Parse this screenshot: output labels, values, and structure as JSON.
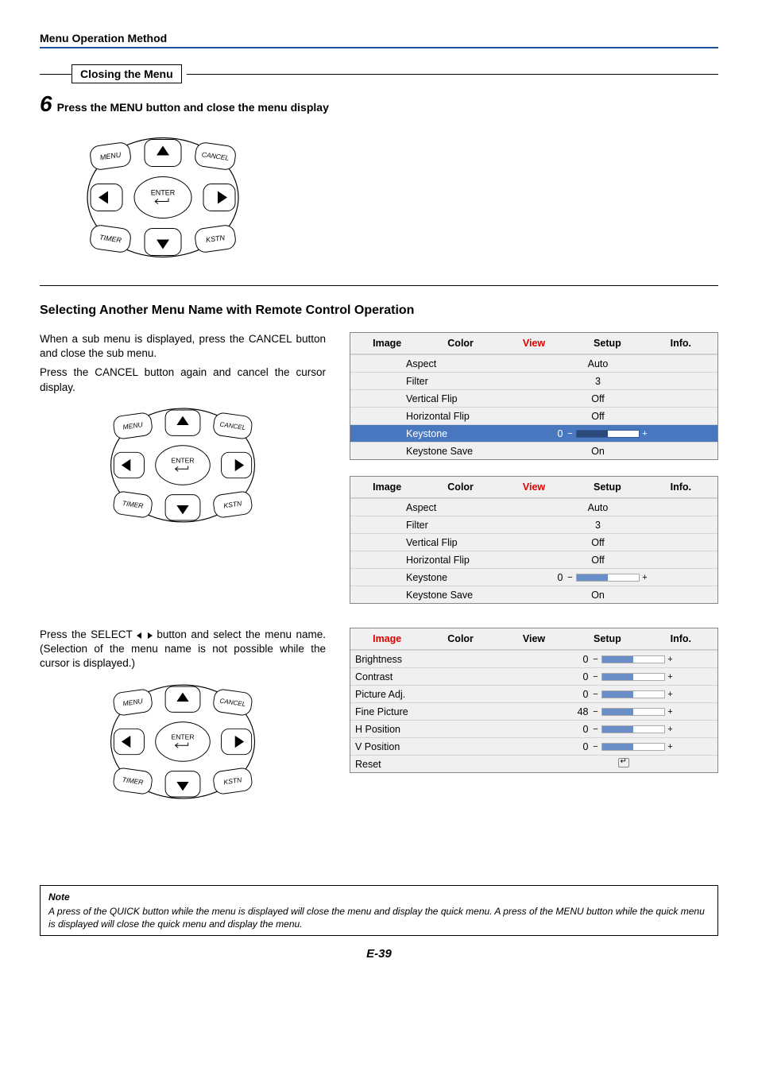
{
  "header": "Menu Operation Method",
  "closing_title": "Closing the Menu",
  "step_num": "6",
  "step_text": "Press the MENU button and close the menu display",
  "remote": {
    "menu": "MENU",
    "cancel": "CANCEL",
    "timer": "TIMER",
    "kstn": "KSTN",
    "enter": "ENTER"
  },
  "subhead": "Selecting Another Menu Name with Remote Control Operation",
  "para1a": "When a sub menu is displayed, press the CANCEL button and close the sub menu.",
  "para1b": "Press the CANCEL button again and cancel the cursor display.",
  "para2a": "Press the SELECT ",
  "para2b": " button and select the menu name. (Selection of the menu name is not possible while the cursor is displayed.)",
  "tabs": [
    "Image",
    "Color",
    "View",
    "Setup",
    "Info."
  ],
  "osd1": {
    "active_tab": "View",
    "rows": [
      {
        "label": "Aspect",
        "value": "Auto"
      },
      {
        "label": "Filter",
        "value": "3"
      },
      {
        "label": "Vertical Flip",
        "value": "Off"
      },
      {
        "label": "Horizontal Flip",
        "value": "Off"
      },
      {
        "label": "Keystone",
        "slider": 0,
        "selected": true
      },
      {
        "label": "Keystone Save",
        "value": "On"
      }
    ]
  },
  "osd2": {
    "active_tab": "View",
    "rows": [
      {
        "label": "Aspect",
        "value": "Auto"
      },
      {
        "label": "Filter",
        "value": "3"
      },
      {
        "label": "Vertical Flip",
        "value": "Off"
      },
      {
        "label": "Horizontal Flip",
        "value": "Off"
      },
      {
        "label": "Keystone",
        "slider": 0
      },
      {
        "label": "Keystone Save",
        "value": "On"
      }
    ]
  },
  "osd3": {
    "active_tab": "Image",
    "rows": [
      {
        "label": "Brightness",
        "slider": 0
      },
      {
        "label": "Contrast",
        "slider": 0
      },
      {
        "label": "Picture Adj.",
        "slider": 0
      },
      {
        "label": "Fine Picture",
        "slider": 48
      },
      {
        "label": "H Position",
        "slider": 0
      },
      {
        "label": "V Position",
        "slider": 0
      },
      {
        "label": "Reset",
        "reset": true
      }
    ]
  },
  "note_label": "Note",
  "note_text": "A press of the QUICK button while the menu is displayed will close the menu and display the quick menu. A press of the MENU button while the quick menu is displayed will close the quick menu and display the menu.",
  "page_num": "E-39"
}
